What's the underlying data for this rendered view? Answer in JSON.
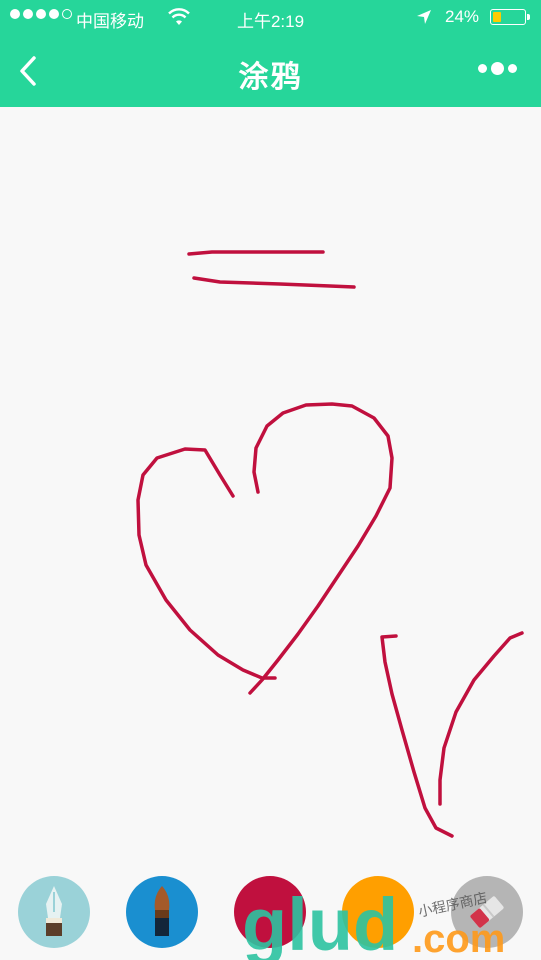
{
  "status_bar": {
    "carrier": "中国移动",
    "time": "上午2:19",
    "battery_percent": "24%",
    "signal_bars_filled": 4,
    "signal_bars_total": 5,
    "icons": [
      "wifi-icon",
      "location-arrow-icon",
      "battery-icon"
    ]
  },
  "nav": {
    "title": "涂鸦",
    "back_icon": "chevron-left-icon",
    "more_icon": "more-dots-icon"
  },
  "canvas": {
    "stroke_color": "#c0103e",
    "background": "#f8f8f8"
  },
  "toolbar": {
    "tools": [
      {
        "name": "pen",
        "icon": "pen-icon",
        "bg": "#9ad2d8"
      },
      {
        "name": "brush",
        "icon": "brush-icon",
        "bg": "#1a8fd0"
      },
      {
        "name": "red-color",
        "icon": "color-swatch-icon",
        "bg": "#c0103e"
      },
      {
        "name": "orange-color",
        "icon": "color-swatch-icon",
        "bg": "#ff9f00"
      },
      {
        "name": "eraser",
        "icon": "eraser-icon",
        "bg": "#b5b5b5"
      }
    ]
  },
  "watermark": {
    "text": "glud",
    "suffix": ".com",
    "caption": "小程序商店"
  },
  "colors": {
    "header": "#26d69a",
    "watermark_green": "#2dc3a1",
    "watermark_orange": "#ff9a1a"
  }
}
